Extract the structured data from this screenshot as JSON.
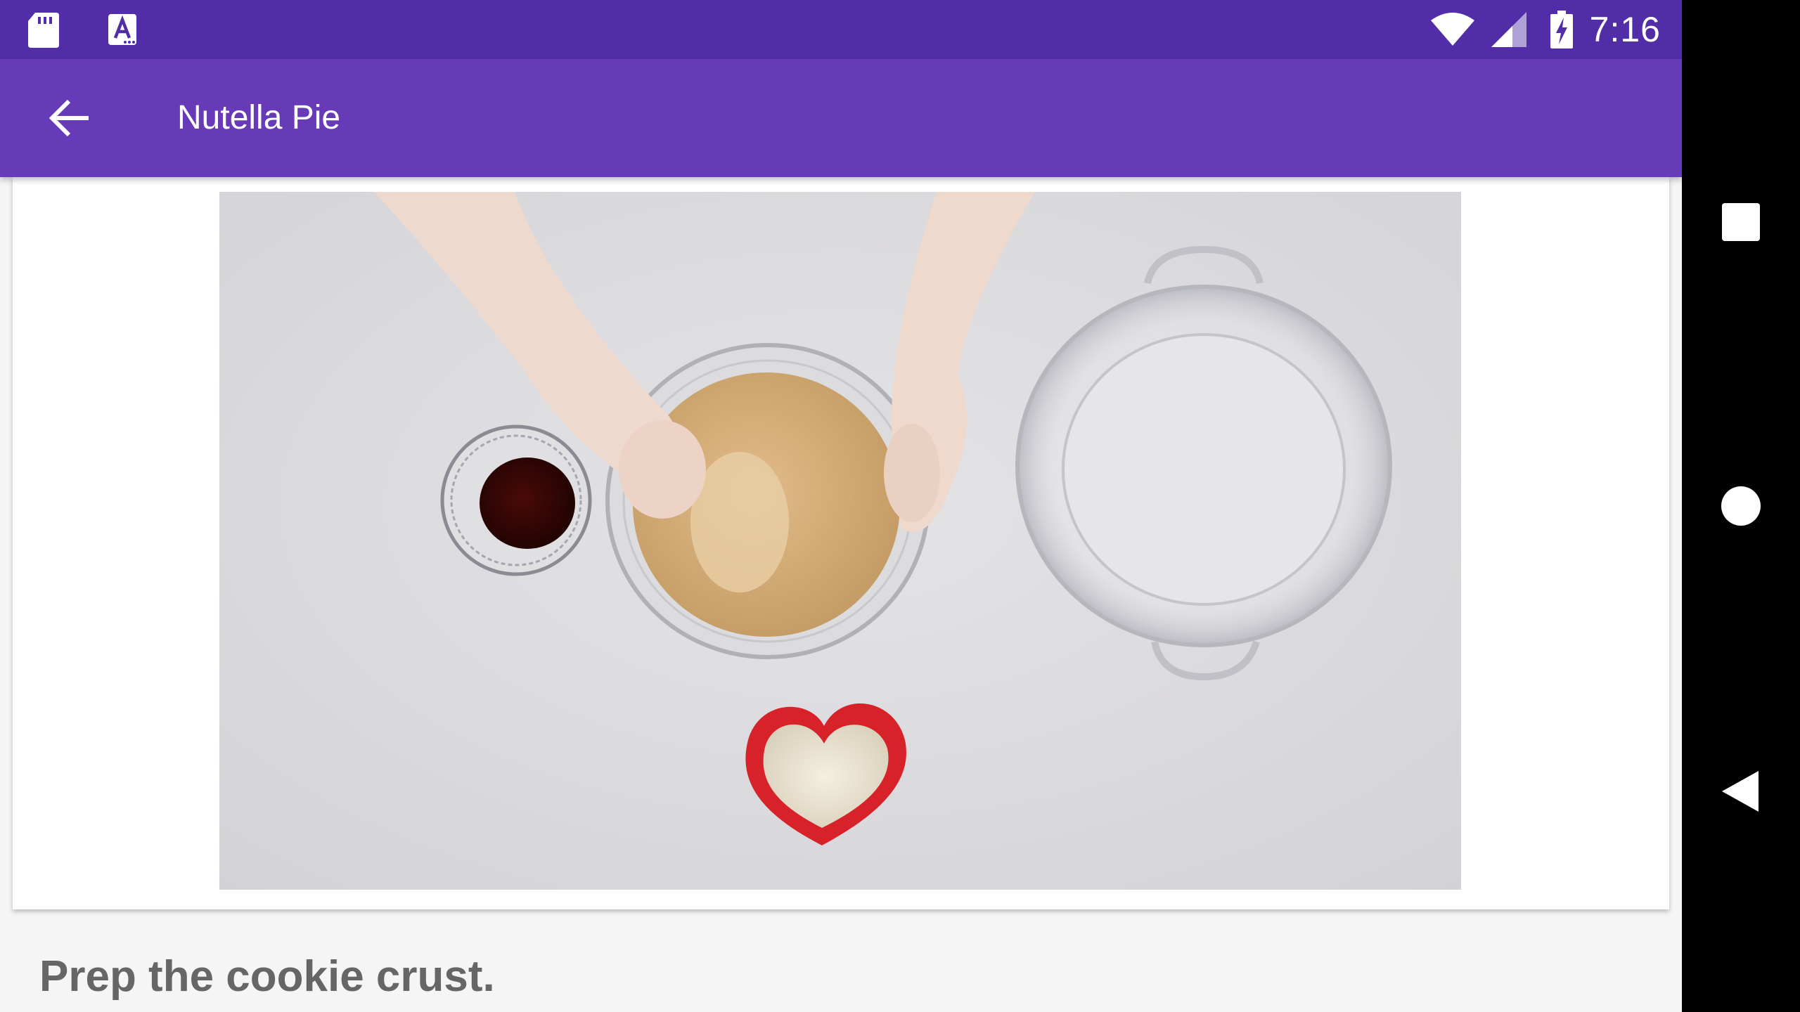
{
  "status_bar": {
    "time": "7:16",
    "left_icons": [
      "sd-card-icon",
      "accessibility-a-icon"
    ],
    "right_icons": [
      "wifi-icon",
      "cell-signal-icon",
      "battery-charging-icon"
    ],
    "color": "#512DA8"
  },
  "app_bar": {
    "title": "Nutella Pie",
    "back_icon": "arrow-back-icon",
    "color": "#673AB7"
  },
  "video": {
    "content": "overhead video of hands mixing graham cracker crumbs in glass bowl"
  },
  "step": {
    "text": "Prep the cookie crust."
  },
  "nav_bar": {
    "buttons": [
      "recents-square-icon",
      "home-circle-icon",
      "back-triangle-icon"
    ]
  }
}
